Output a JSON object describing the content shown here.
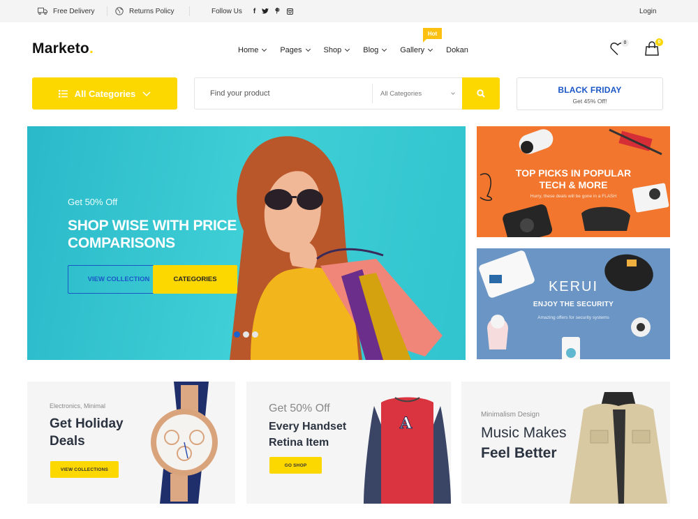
{
  "topbar": {
    "free_delivery": "Free Delivery",
    "returns_policy": "Returns Policy",
    "follow_us": "Follow Us",
    "social": [
      "facebook",
      "twitter",
      "pinterest",
      "instagram"
    ],
    "social_glyphs": [
      "f",
      "t",
      "p",
      "◎"
    ],
    "login": "Login"
  },
  "brand": {
    "name": "Marketo",
    "dot": ".",
    "accent": "#fdd700"
  },
  "nav": {
    "items": [
      {
        "label": "Home",
        "has_dropdown": true
      },
      {
        "label": "Pages",
        "has_dropdown": true
      },
      {
        "label": "Shop",
        "has_dropdown": true
      },
      {
        "label": "Blog",
        "has_dropdown": true
      },
      {
        "label": "Gallery",
        "has_dropdown": true
      },
      {
        "label": "Dokan",
        "has_dropdown": false
      }
    ],
    "hot_badge": "Hot"
  },
  "header_icons": {
    "wishlist_count": "0",
    "cart_count": "0"
  },
  "search": {
    "all_categories_label": "All Categories",
    "placeholder": "Find your product",
    "category_select": "All Categories"
  },
  "black_friday": {
    "title": "BLACK FRIDAY",
    "subtitle": "Get 45% Off!"
  },
  "hero": {
    "subtitle": "Get 50% Off",
    "title": "SHOP WISE WITH PRICE COMPARISONS",
    "btn_view": "VIEW COLLECTION",
    "btn_categories": "CATEGORIES",
    "slides": 3,
    "active_slide": 1
  },
  "side_banners": [
    {
      "title_line1": "TOP PICKS IN POPULAR",
      "title_line2": "TECH & MORE",
      "subtitle": "Hurry, these deals will be gone in a FLASH"
    },
    {
      "brand": "KERUI",
      "title": "ENJOY THE SECURITY",
      "subtitle": "Amazing offers for security systems"
    }
  ],
  "promos": [
    {
      "kicker": "Electronics, Minimal",
      "title_line1": "Get Holiday",
      "title_line2": "Deals",
      "button": "VIEW COLLECTIONS"
    },
    {
      "kicker": "Get 50% Off",
      "title_line1": "Every Handset",
      "title_line2": "Retina Item",
      "button": "GO SHOP"
    },
    {
      "kicker": "Minimalism Design",
      "title_line1": "Music Makes",
      "title_line2": "Feel Better"
    }
  ],
  "colors": {
    "yellow": "#fdd700",
    "blue": "#1a56c7",
    "hot": "#fcc110"
  }
}
